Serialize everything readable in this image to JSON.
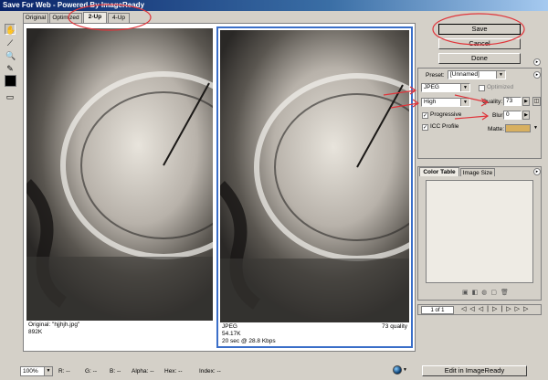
{
  "window": {
    "title": "Save For Web - Powered By ImageReady"
  },
  "tabs": [
    {
      "label": "Original"
    },
    {
      "label": "Optimized"
    },
    {
      "label": "2-Up"
    },
    {
      "label": "4-Up"
    }
  ],
  "panes": {
    "original": {
      "line1": "Original: \"hjjhjh.jpg\"",
      "line2": "892K"
    },
    "optimized": {
      "line1": "JPEG",
      "line2": "54.17K",
      "line3": "20 sec @ 28.8 Kbps",
      "quality_text": "73 quality"
    }
  },
  "buttons": {
    "save": "Save",
    "cancel": "Cancel",
    "done": "Done",
    "edit_in_imageready": "Edit in ImageReady"
  },
  "settings": {
    "preset_label": "Preset:",
    "preset_value": "[Unnamed]",
    "format_value": "JPEG",
    "optimized_label": "Optimized",
    "quality_preset_value": "High",
    "quality_label": "Quality:",
    "quality_value": "73",
    "blur_label": "Blur:",
    "blur_value": "0",
    "matte_label": "Matte:",
    "progressive_label": "Progressive",
    "icc_label": "ICC Profile",
    "matte_color": "#d8b060"
  },
  "palette": {
    "tab_color_table": "Color Table",
    "tab_image_size": "Image Size",
    "page_indicator": "1 of 1"
  },
  "statusbar": {
    "zoom": "100%",
    "r": "R: --",
    "g": "G: --",
    "b": "B: --",
    "alpha": "Alpha: --",
    "hex": "Hex: --",
    "index": "Index: --"
  },
  "annotation_color": "#e0343a"
}
